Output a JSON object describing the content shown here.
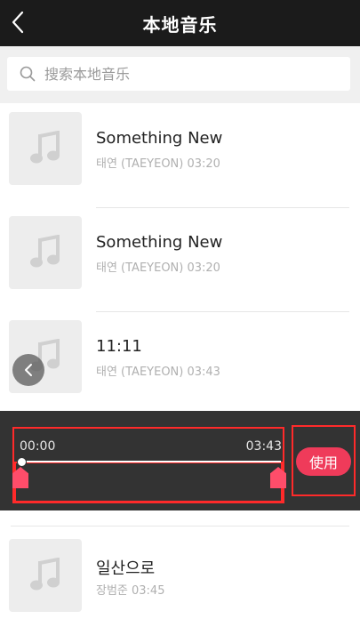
{
  "header": {
    "title": "本地音乐",
    "back_icon": "chevron-left-icon"
  },
  "search": {
    "placeholder": "搜索本地音乐",
    "icon": "search-icon"
  },
  "songs": [
    {
      "title": "Something New",
      "subtitle": "태연 (TAEYEON) 03:20"
    },
    {
      "title": "Something New",
      "subtitle": "태연 (TAEYEON) 03:20"
    },
    {
      "title": "11:11",
      "subtitle": "태연 (TAEYEON) 03:43"
    },
    {
      "title": "일산으로",
      "subtitle": "장범준 03:45"
    }
  ],
  "trim": {
    "start_time": "00:00",
    "end_time": "03:43",
    "use_label": "使用",
    "highlight_color": "#ff2a2a",
    "accent_color": "#ef3b5a"
  }
}
